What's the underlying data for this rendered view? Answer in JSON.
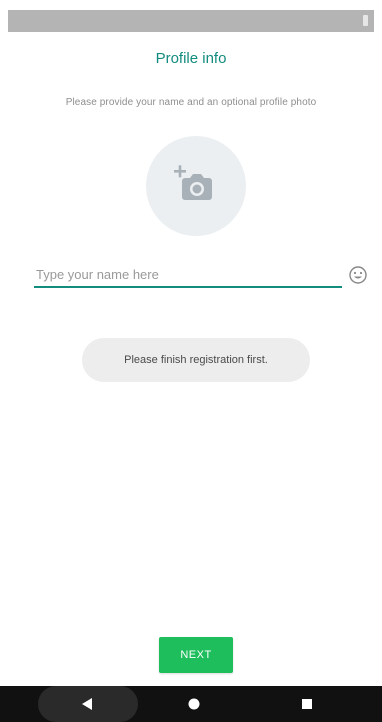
{
  "header": {
    "title": "Profile info",
    "subtitle": "Please provide your name and an optional profile photo"
  },
  "profile_photo": {
    "icon": "add-camera-icon"
  },
  "name_input": {
    "placeholder": "Type your name here",
    "value": ""
  },
  "emoji": {
    "icon": "smiley-icon"
  },
  "toast": {
    "message": "Please finish registration first."
  },
  "actions": {
    "next_label": "NEXT"
  },
  "nav": {
    "back_icon": "back-triangle-icon",
    "home_icon": "home-circle-icon",
    "recents_icon": "recents-square-icon"
  },
  "colors": {
    "accent": "#128c7e",
    "button": "#1ebe5d"
  }
}
